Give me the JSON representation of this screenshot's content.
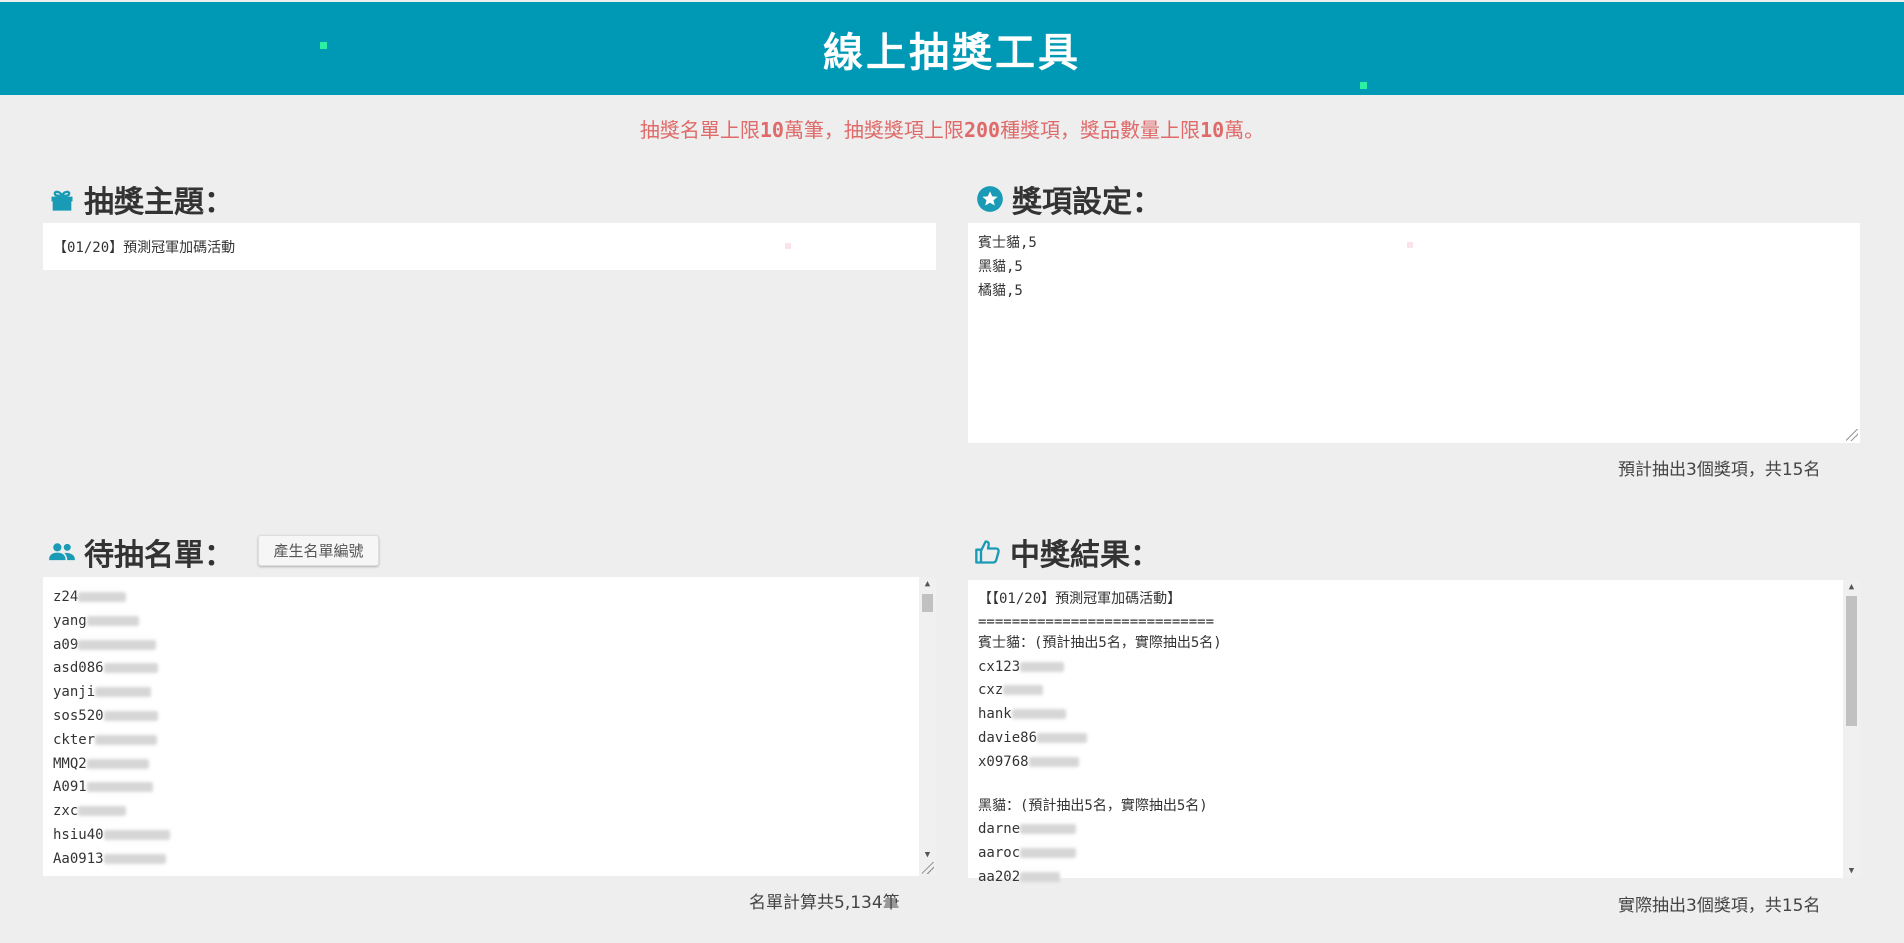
{
  "header": {
    "title": "線上抽獎工具"
  },
  "notice": {
    "parts": [
      "抽獎名單上限",
      "10",
      "萬筆，抽獎獎項上限",
      "200",
      "種獎項，獎品數量上限",
      "10",
      "萬。"
    ]
  },
  "topic": {
    "title": "抽獎主題：",
    "icon": "gift-icon",
    "value": "【01/20】預測冠軍加碼活動"
  },
  "prizes": {
    "title": "獎項設定：",
    "icon": "star-circle-icon",
    "lines": [
      "賓士貓,5",
      "黑貓,5",
      "橘貓,5"
    ],
    "summary": "預計抽出3個獎項，共15名"
  },
  "candidates": {
    "title": "待抽名單：",
    "icon": "people-icon",
    "button_label": "產生名單編號",
    "entries": [
      "z24",
      "yang",
      "a09",
      "asd086",
      "yanji",
      "sos520",
      "ckter",
      "MMQ2",
      "A091",
      "zxc",
      "hsiu40",
      "Aa0913"
    ],
    "summary": "名單計算共5,134筆"
  },
  "results": {
    "title": "中獎結果：",
    "icon": "thumbs-up-icon",
    "lines": [
      "【【01/20】預測冠軍加碼活動】",
      "============================",
      "賓士貓：(預計抽出5名，實際抽出5名)",
      "cx123",
      "cxz",
      "hank",
      "davie86",
      "x09768",
      "",
      "黑貓：(預計抽出5名，實際抽出5名)",
      "darne",
      "aaroc",
      "aa202"
    ],
    "summary": "實際抽出3個獎項，共15名"
  },
  "colors": {
    "header_bg": "#0099b5",
    "notice_text": "#e06a6a",
    "icon_teal": "#1a9bb5",
    "page_bg": "#eeeeee"
  }
}
